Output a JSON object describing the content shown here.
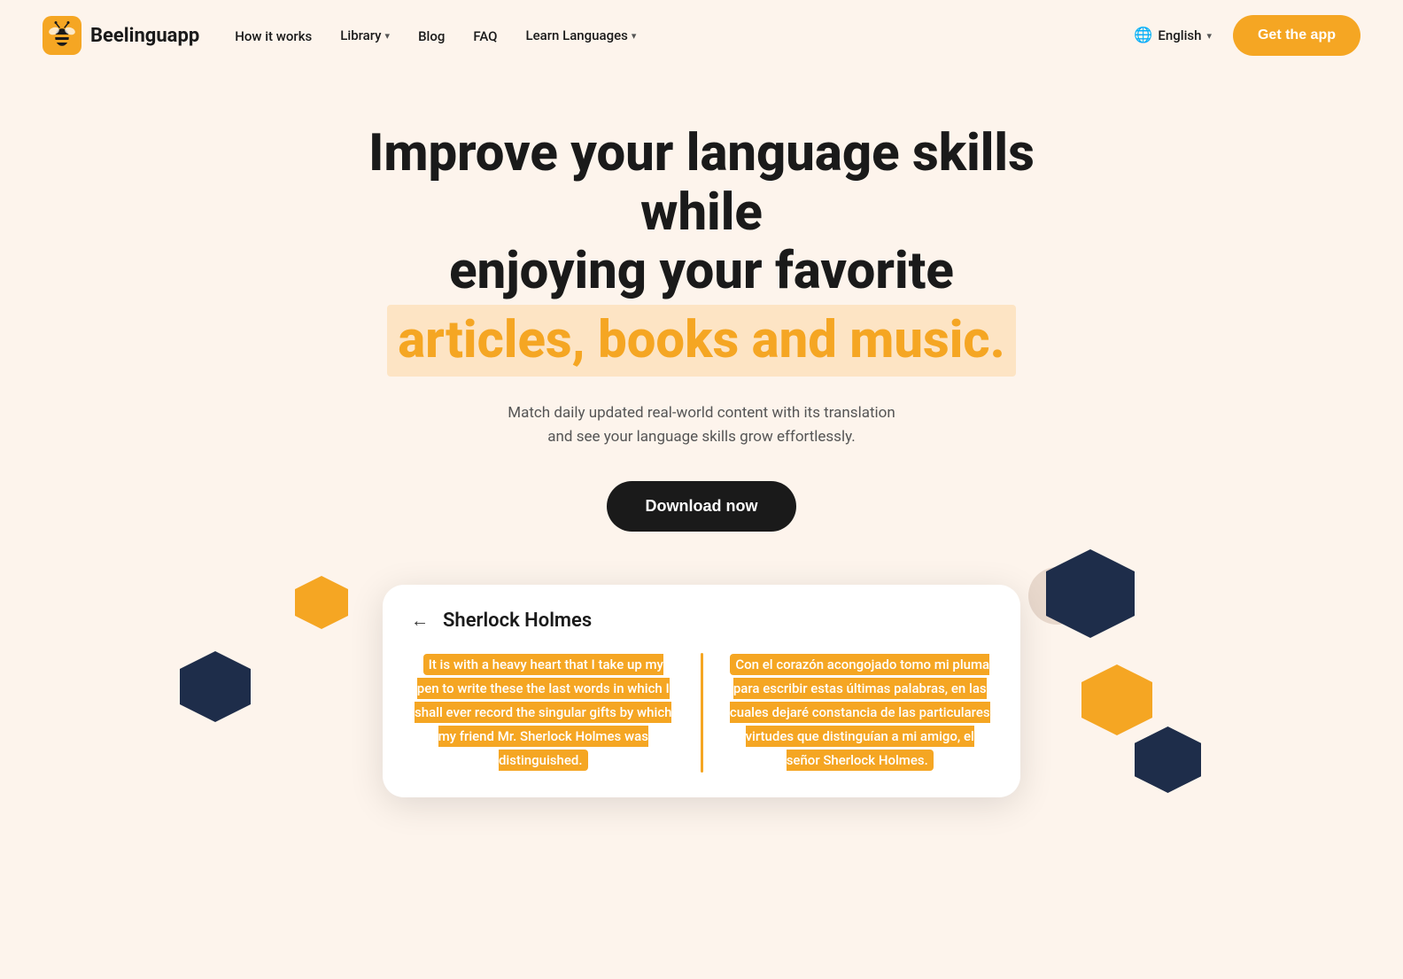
{
  "logo": {
    "text": "Beelinguapp"
  },
  "nav": {
    "links": [
      {
        "label": "How it works",
        "hasDropdown": false
      },
      {
        "label": "Library",
        "hasDropdown": true
      },
      {
        "label": "Blog",
        "hasDropdown": false
      },
      {
        "label": "FAQ",
        "hasDropdown": false
      },
      {
        "label": "Learn Languages",
        "hasDropdown": true
      }
    ],
    "language": "English",
    "get_app_label": "Get the app"
  },
  "hero": {
    "title_line1": "Improve your language skills while",
    "title_line2": "enjoying your favorite",
    "title_highlight": "articles, books and music.",
    "subtitle": "Match daily updated real-world content with its translation and see your language skills grow effortlessly.",
    "download_label": "Download now"
  },
  "app_card": {
    "back_label": "←",
    "title": "Sherlock Holmes",
    "english_text": "It is with a heavy heart that I take up my pen to write these the last words in which I shall ever record the singular gifts by which my friend Mr. Sherlock Holmes was distinguished.",
    "spanish_text": "Con el corazón acongojado tomo mi pluma para escribir estas últimas palabras, en las cuales dejaré constancia de las particulares virtudes que distinguían a mi amigo, el señor Sherlock Holmes."
  },
  "shapes": {
    "orange_small": "#f5a623",
    "dark_navy": "#1e2d4a",
    "light_peach": "#e8d8cc"
  }
}
